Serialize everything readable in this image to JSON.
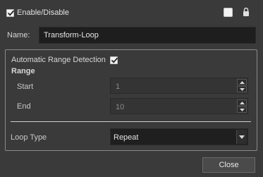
{
  "header": {
    "enable_label": "Enable/Disable",
    "enable_checked": true,
    "color_swatch_icon": "white-swatch-icon",
    "lock_icon": "lock-icon"
  },
  "name": {
    "label": "Name:",
    "value": "Transform-Loop"
  },
  "range_group": {
    "auto_detect_label": "Automatic Range Detection",
    "auto_detect_checked": true,
    "range_label": "Range",
    "start_label": "Start",
    "start_value": "1",
    "end_label": "End",
    "end_value": "10"
  },
  "loop": {
    "label": "Loop Type",
    "value": "Repeat"
  },
  "footer": {
    "close_label": "Close"
  },
  "colors": {
    "background": "#3a3a3a",
    "field_bg": "#1e1e1e",
    "text": "#d6d6d6"
  }
}
